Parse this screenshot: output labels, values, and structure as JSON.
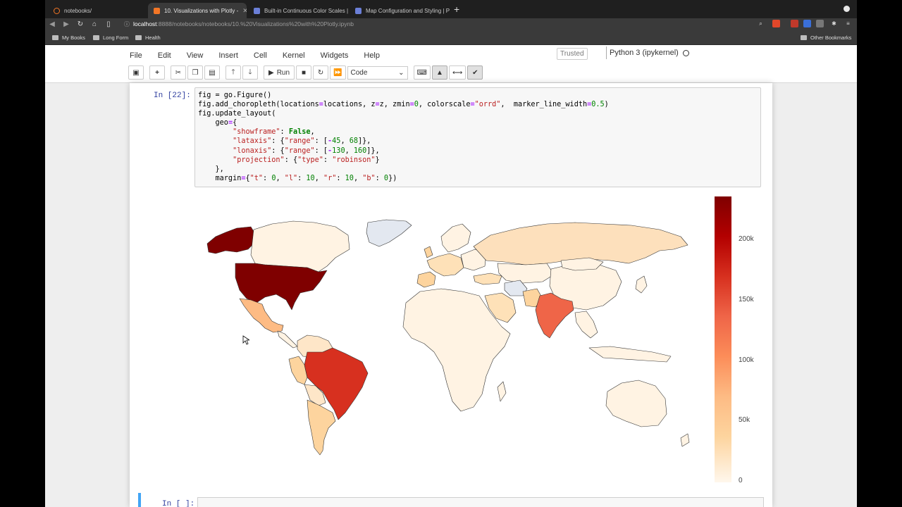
{
  "browser": {
    "tabs": [
      {
        "title": "notebooks/",
        "icon_color": "#f37626"
      },
      {
        "title": "10. Visualizations with Plotly -",
        "icon_color": "#f37626"
      },
      {
        "title": "Built-in Continuous Color Scales | P",
        "icon_color": "#6b7fd7"
      },
      {
        "title": "Map Configuration and Styling | Pyt",
        "icon_color": "#6b7fd7"
      }
    ],
    "url_host": "localhost",
    "url_path": ":8888/notebooks/notebooks/10.%20Visualizations%20with%20Plotly.ipynb",
    "bookmarks": [
      "My Books",
      "Long Form",
      "Health"
    ],
    "other_bookmarks": "Other Bookmarks"
  },
  "jupyter": {
    "menu": [
      "File",
      "Edit",
      "View",
      "Insert",
      "Cell",
      "Kernel",
      "Widgets",
      "Help"
    ],
    "trusted": "Trusted",
    "kernel": "Python 3 (ipykernel)",
    "run_label": "Run",
    "cell_type": "Code"
  },
  "cell": {
    "prompt": "In [22]:",
    "next_prompt": "In [ ]:"
  },
  "colors": {
    "scale": [
      "#fff7ec",
      "#fdd49e",
      "#fdbb84",
      "#fc8d59",
      "#ef6548",
      "#d7301f",
      "#b30000",
      "#7f0000"
    ]
  },
  "chart_data": {
    "type": "choropleth",
    "colorscale": "orrd",
    "zmin": 0,
    "projection": "robinson",
    "colorbar_ticks": [
      "200k",
      "150k",
      "100k",
      "50k",
      "0"
    ],
    "colorbar_tick_values": [
      200000,
      150000,
      100000,
      50000,
      0
    ],
    "zmax_estimate": 230000,
    "regions": [
      {
        "name": "United States",
        "z": 230000
      },
      {
        "name": "Alaska",
        "z": 230000
      },
      {
        "name": "Brazil",
        "z": 160000
      },
      {
        "name": "India",
        "z": 130000
      },
      {
        "name": "Mexico",
        "z": 65000
      },
      {
        "name": "Canada",
        "z": 5000
      },
      {
        "name": "Greenland",
        "z": 0
      },
      {
        "name": "Russia",
        "z": 20000
      },
      {
        "name": "Iran",
        "z": 30000
      },
      {
        "name": "Peru",
        "z": 25000
      },
      {
        "name": "Argentina",
        "z": 25000
      },
      {
        "name": "Spain",
        "z": 35000
      }
    ]
  }
}
